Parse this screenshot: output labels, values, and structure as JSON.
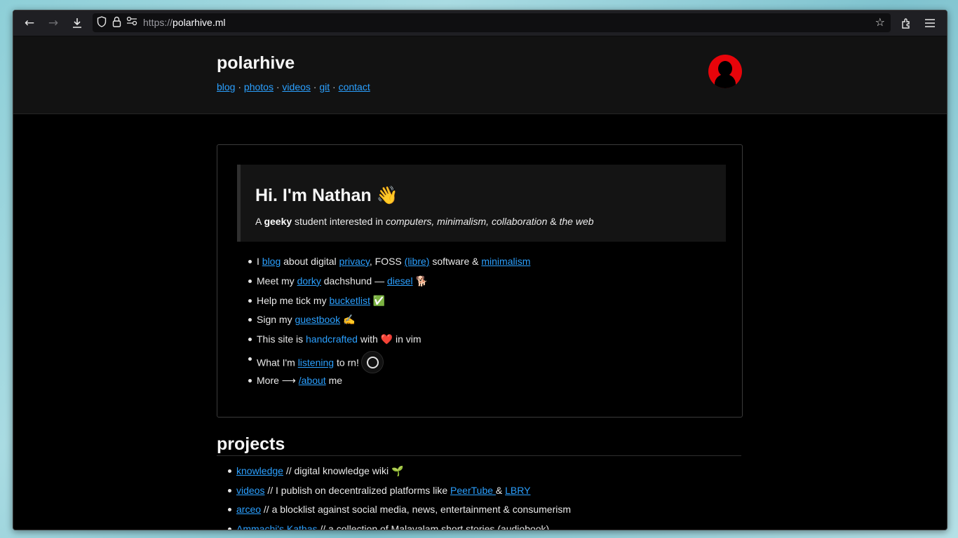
{
  "browser": {
    "url_scheme": "https://",
    "url_host": "polarhive.ml",
    "icons": [
      "back-arrow-icon",
      "forward-arrow-icon",
      "download-icon",
      "shield-icon",
      "lock-icon",
      "permissions-icon",
      "bookmark-star-icon",
      "extensions-icon",
      "menu-icon"
    ]
  },
  "site": {
    "title": "polarhive",
    "nav": [
      {
        "label": "blog"
      },
      {
        "label": "photos"
      },
      {
        "label": "videos"
      },
      {
        "label": "git"
      },
      {
        "label": "contact"
      }
    ],
    "separator": "·"
  },
  "hero": {
    "title": "Hi. I'm Nathan 👋",
    "sub_pre": "A ",
    "sub_bold": "geeky",
    "sub_mid": " student interested in ",
    "sub_italic": "computers, minimalism, collaboration",
    "sub_amp": " & ",
    "sub_italic2": "the web"
  },
  "facts": {
    "f1": {
      "t1": "I ",
      "l1": "blog",
      "t2": " about digital ",
      "l2": "privacy",
      "t3": ", FOSS ",
      "l3": "(libre)",
      "t4": " software & ",
      "l4": "minimalism"
    },
    "f2": {
      "t1": "Meet my ",
      "l1": "dorky",
      "t2": " dachshund — ",
      "l2": "diesel",
      "t3": " 🐕"
    },
    "f3": {
      "t1": "Help me tick my ",
      "l1": "bucketlist",
      "t2": " ✅"
    },
    "f4": {
      "t1": "Sign my ",
      "l1": "guestbook",
      "t2": " ✍️"
    },
    "f5": {
      "t1": "This site is ",
      "l1": "handcrafted",
      "t2": " with ",
      "heart": "❤️",
      "t3": " in vim"
    },
    "f6": {
      "t1": "What I'm ",
      "l1": "listening",
      "t2": " to rn!"
    },
    "f7": {
      "t1": "More ⟶ ",
      "l1": "/about",
      "t2": " me"
    }
  },
  "projects": {
    "heading": "projects",
    "p1": {
      "l1": "knowledge",
      "t1": " // digital knowledge wiki 🌱"
    },
    "p2": {
      "l1": "videos",
      "t1": " // I publish on decentralized platforms like ",
      "l2": "PeerTube ",
      "t2": "& ",
      "l3": "LBRY"
    },
    "p3": {
      "l1": "arceo",
      "t1": " // a blocklist against social media, news, entertainment & consumerism"
    },
    "p4": {
      "l1": "Ammachi's Kathas",
      "t1": " // a collection of Malayalam short stories (audiobook)"
    }
  },
  "colors": {
    "link": "#2ba0ff",
    "accent_avatar": "#e8040a",
    "page_bg": "#000000"
  }
}
